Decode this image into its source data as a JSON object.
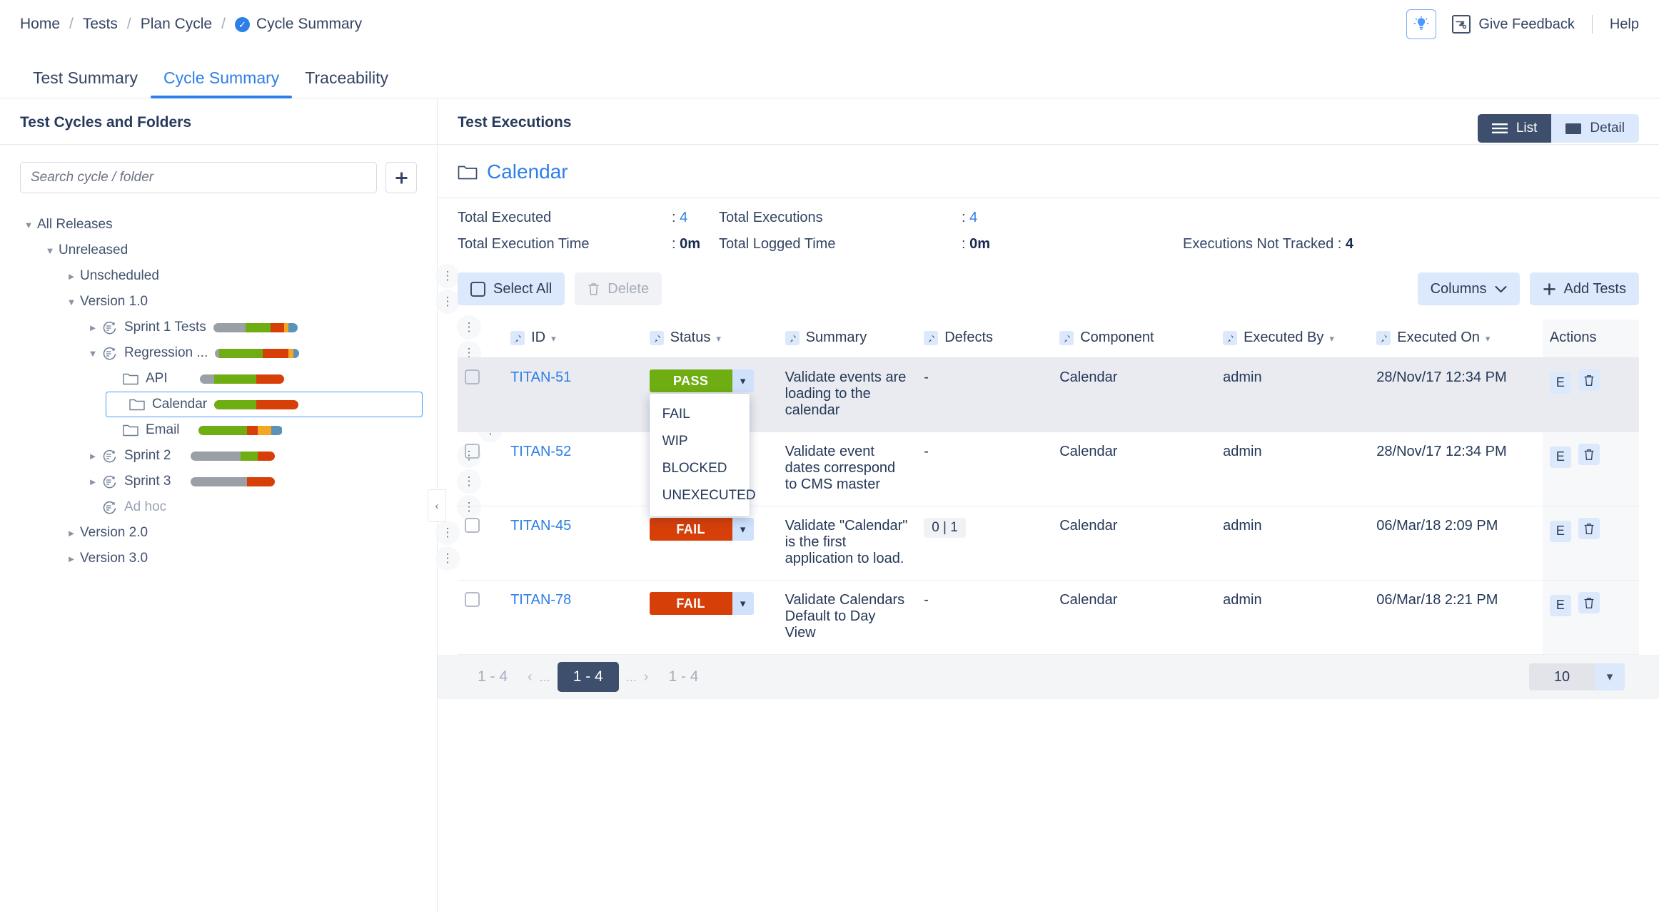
{
  "breadcrumb": {
    "items": [
      "Home",
      "Tests",
      "Plan Cycle",
      "Cycle Summary"
    ],
    "separator": "/"
  },
  "header": {
    "give_feedback": "Give Feedback",
    "help": "Help"
  },
  "tabs": [
    {
      "label": "Test Summary",
      "active": false
    },
    {
      "label": "Cycle Summary",
      "active": true
    },
    {
      "label": "Traceability",
      "active": false
    }
  ],
  "sidebar": {
    "title": "Test Cycles and Folders",
    "search_placeholder": "Search cycle / folder",
    "search_value": "",
    "add_label": "+",
    "tree": [
      {
        "label": "All Releases",
        "depth": 0,
        "caret": "down",
        "icon": "none",
        "bar": null,
        "kebab": false,
        "selected": false,
        "muted": false
      },
      {
        "label": "Unreleased",
        "depth": 1,
        "caret": "down",
        "icon": "none",
        "bar": null,
        "kebab": false,
        "selected": false,
        "muted": false
      },
      {
        "label": "Unscheduled",
        "depth": 2,
        "caret": "right",
        "icon": "none",
        "bar": null,
        "kebab": true,
        "selected": false,
        "muted": false
      },
      {
        "label": "Version 1.0",
        "depth": 2,
        "caret": "down",
        "icon": "none",
        "bar": null,
        "kebab": true,
        "selected": false,
        "muted": false
      },
      {
        "label": "Sprint 1 Tests",
        "depth": 3,
        "caret": "right",
        "icon": "cycle-icon",
        "bar": [
          [
            38,
            "#9aa0a6"
          ],
          [
            30,
            "#6fae12"
          ],
          [
            16,
            "#d73f09"
          ],
          [
            5,
            "#f5a623"
          ],
          [
            11,
            "#5b92b8"
          ]
        ],
        "kebab": true,
        "selected": false,
        "muted": false
      },
      {
        "label": "Regression ...",
        "depth": 3,
        "caret": "down",
        "icon": "cycle-icon",
        "bar": [
          [
            5,
            "#9aa0a6"
          ],
          [
            52,
            "#6fae12"
          ],
          [
            30,
            "#d73f09"
          ],
          [
            6,
            "#f5a623"
          ],
          [
            7,
            "#5b92b8"
          ]
        ],
        "kebab": true,
        "selected": false,
        "muted": false
      },
      {
        "label": "API",
        "depth": 4,
        "caret": "none",
        "icon": "folder-icon",
        "bar": [
          [
            17,
            "#9aa0a6"
          ],
          [
            50,
            "#6fae12"
          ],
          [
            33,
            "#d73f09"
          ]
        ],
        "kebab": true,
        "selected": false,
        "muted": false
      },
      {
        "label": "Calendar",
        "depth": 4,
        "caret": "none",
        "icon": "folder-icon",
        "bar": [
          [
            50,
            "#6fae12"
          ],
          [
            50,
            "#d73f09"
          ]
        ],
        "kebab": true,
        "selected": true,
        "muted": false
      },
      {
        "label": "Email",
        "depth": 4,
        "caret": "none",
        "icon": "folder-icon",
        "bar": [
          [
            58,
            "#6fae12"
          ],
          [
            13,
            "#d73f09"
          ],
          [
            16,
            "#f5a623"
          ],
          [
            13,
            "#5b92b8"
          ]
        ],
        "kebab": true,
        "selected": false,
        "muted": false
      },
      {
        "label": "Sprint 2",
        "depth": 3,
        "caret": "right",
        "icon": "cycle-icon",
        "bar": [
          [
            60,
            "#9aa0a6"
          ],
          [
            20,
            "#6fae12"
          ],
          [
            20,
            "#d73f09"
          ]
        ],
        "kebab": true,
        "selected": false,
        "muted": false
      },
      {
        "label": "Sprint 3",
        "depth": 3,
        "caret": "right",
        "icon": "cycle-icon",
        "bar": [
          [
            67,
            "#9aa0a6"
          ],
          [
            33,
            "#d73f09"
          ]
        ],
        "kebab": true,
        "selected": false,
        "muted": false
      },
      {
        "label": "Ad hoc",
        "depth": 3,
        "caret": "none",
        "icon": "cycle-icon",
        "bar": null,
        "kebab": true,
        "selected": false,
        "muted": true
      },
      {
        "label": "Version 2.0",
        "depth": 2,
        "caret": "right",
        "icon": "none",
        "bar": null,
        "kebab": true,
        "selected": false,
        "muted": false
      },
      {
        "label": "Version 3.0",
        "depth": 2,
        "caret": "right",
        "icon": "none",
        "bar": null,
        "kebab": true,
        "selected": false,
        "muted": false
      }
    ]
  },
  "content": {
    "title": "Test Executions",
    "folder_name": "Calendar",
    "view_toggle": {
      "list": "List",
      "detail": "Detail",
      "active": "List"
    },
    "stats": [
      {
        "label": "Total Executed",
        "value": "4",
        "accent": true
      },
      {
        "label": "Total Executions",
        "value": "4",
        "accent": true
      },
      {
        "label": "Total Execution Time",
        "value": "0m",
        "accent": false
      },
      {
        "label": "Total Logged Time",
        "value": "0m",
        "accent": false
      }
    ],
    "executions_not_tracked": {
      "label": "Executions Not Tracked",
      "value": "4"
    },
    "toolbar": {
      "select_all": "Select All",
      "delete": "Delete",
      "columns": "Columns",
      "add_tests": "Add Tests"
    },
    "table": {
      "columns": [
        {
          "label": "ID",
          "pin": true,
          "sortable": true
        },
        {
          "label": "Status",
          "pin": true,
          "sortable": true
        },
        {
          "label": "Summary",
          "pin": true,
          "sortable": false
        },
        {
          "label": "Defects",
          "pin": true,
          "sortable": false
        },
        {
          "label": "Component",
          "pin": true,
          "sortable": false
        },
        {
          "label": "Executed By",
          "pin": true,
          "sortable": true
        },
        {
          "label": "Executed On",
          "pin": true,
          "sortable": true
        },
        {
          "label": "Actions",
          "pin": false,
          "sortable": false
        }
      ],
      "rows": [
        {
          "id": "TITAN-51",
          "status": "PASS",
          "status_color": "#6fae12",
          "summary": "Validate events are loading to the calendar",
          "defects": "-",
          "defects_badge": false,
          "component": "Calendar",
          "executed_by": "admin",
          "executed_on": "28/Nov/17 12:34 PM",
          "highlighted": true,
          "menu_open": true
        },
        {
          "id": "TITAN-52",
          "status": "",
          "status_color": "",
          "summary": "Validate event dates correspond to CMS master",
          "defects": "-",
          "defects_badge": false,
          "component": "Calendar",
          "executed_by": "admin",
          "executed_on": "28/Nov/17 12:34 PM",
          "highlighted": false,
          "menu_open": false
        },
        {
          "id": "TITAN-45",
          "status": "FAIL",
          "status_color": "#d73f09",
          "summary": "Validate \"Calendar\" is the first application to load.",
          "defects": "0 | 1",
          "defects_badge": true,
          "component": "Calendar",
          "executed_by": "admin",
          "executed_on": "06/Mar/18 2:09 PM",
          "highlighted": false,
          "menu_open": false
        },
        {
          "id": "TITAN-78",
          "status": "FAIL",
          "status_color": "#d73f09",
          "summary": "Validate Calendars Default to Day View",
          "defects": "-",
          "defects_badge": false,
          "component": "Calendar",
          "executed_by": "admin",
          "executed_on": "06/Mar/18 2:21 PM",
          "highlighted": false,
          "menu_open": false
        }
      ],
      "status_menu_options": [
        "FAIL",
        "WIP",
        "BLOCKED",
        "UNEXECUTED"
      ],
      "action_buttons": {
        "edit": "E",
        "delete": "delete-icon"
      }
    },
    "pagination": {
      "left_label": "1 - 4",
      "current": "1 - 4",
      "right_label": "1 - 4",
      "dots": "...",
      "prev": "‹",
      "next": "›",
      "page_size": "10"
    }
  },
  "colors": {
    "accent": "#2e7fe8",
    "pass": "#6fae12",
    "fail": "#d73f09",
    "wip": "#f5a623",
    "blocked": "#5b92b8",
    "unexecuted": "#9aa0a6",
    "dark": "#3d4f6d"
  }
}
